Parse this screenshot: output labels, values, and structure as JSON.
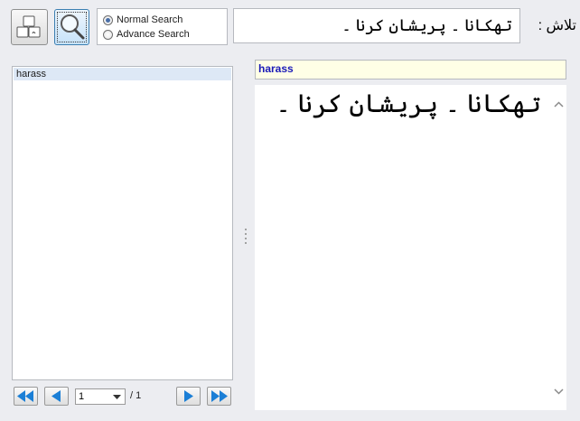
{
  "toolbar": {
    "keyboard_icon": "keyboard-icon",
    "search_icon": "magnifier-icon",
    "search_mode": {
      "options": [
        "Normal Search",
        "Advance Search"
      ],
      "selected": "Normal Search"
    }
  },
  "search": {
    "label": "تلاش :",
    "value": "تھکانا ۔ پریشان کرنا ۔"
  },
  "results": {
    "items": [
      "harass"
    ],
    "selected": "harass"
  },
  "entry": {
    "word": "harass",
    "meaning": "تھکانا ۔ پریشان کرنا ۔"
  },
  "pagination": {
    "current_page": "1",
    "total_label": "/ 1"
  },
  "colors": {
    "accent": "#2176c8",
    "word_bar_bg": "#ffffe6",
    "word_text": "#1b1bb8"
  }
}
